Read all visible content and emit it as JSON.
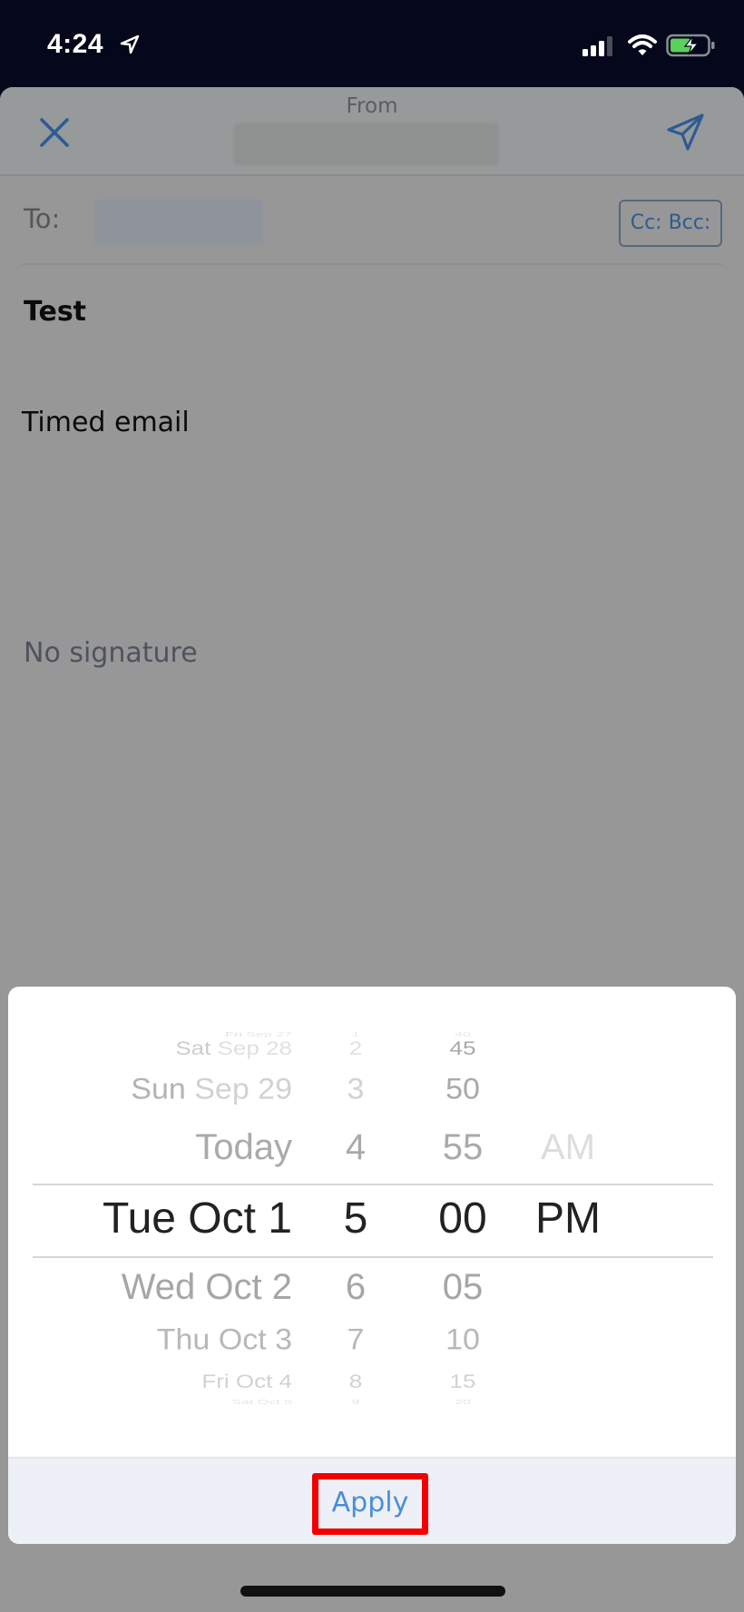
{
  "status_bar": {
    "time": "4:24",
    "icons": [
      "location-arrow-icon",
      "cellular-signal-icon",
      "wifi-icon",
      "battery-charging-icon"
    ]
  },
  "compose": {
    "close_icon": "close-icon",
    "from_label": "From",
    "from_value": "",
    "send_icon": "send-icon",
    "to_label": "To:",
    "to_value": "",
    "cc_bcc_label": "Cc: Bcc:",
    "subject": "Test",
    "body": "Timed email",
    "signature": "No signature"
  },
  "picker": {
    "columns": [
      "date",
      "hour",
      "minute",
      "ampm"
    ],
    "rows": [
      {
        "date_prefix": "Fri",
        "date_rest": "Sep 27",
        "hour": "1",
        "minute": "40",
        "ampm": ""
      },
      {
        "date_prefix": "Sat",
        "date_rest": "Sep 28",
        "hour": "2",
        "minute": "45",
        "ampm": ""
      },
      {
        "date_prefix": "Sun",
        "date_rest": "Sep 29",
        "hour": "3",
        "minute": "50",
        "ampm": ""
      },
      {
        "date_prefix": "",
        "date_rest": "Today",
        "hour": "4",
        "minute": "55",
        "ampm": "AM"
      },
      {
        "date_prefix": "",
        "date_rest": "Tue Oct 1",
        "hour": "5",
        "minute": "00",
        "ampm": "PM"
      },
      {
        "date_prefix": "",
        "date_rest": "Wed Oct 2",
        "hour": "6",
        "minute": "05",
        "ampm": ""
      },
      {
        "date_prefix": "",
        "date_rest": "Thu Oct 3",
        "hour": "7",
        "minute": "10",
        "ampm": ""
      },
      {
        "date_prefix": "",
        "date_rest": "Fri Oct 4",
        "hour": "8",
        "minute": "15",
        "ampm": ""
      },
      {
        "date_prefix": "",
        "date_rest": "Sat Oct 5",
        "hour": "9",
        "minute": "20",
        "ampm": ""
      }
    ],
    "selected": {
      "date": "Tue Oct 1",
      "hour": "5",
      "minute": "00",
      "ampm": "PM"
    },
    "apply_label": "Apply"
  },
  "colors": {
    "accent_blue": "#4a8ed8",
    "highlight_red": "#f20000",
    "icon_blue": "#2f5a93"
  }
}
